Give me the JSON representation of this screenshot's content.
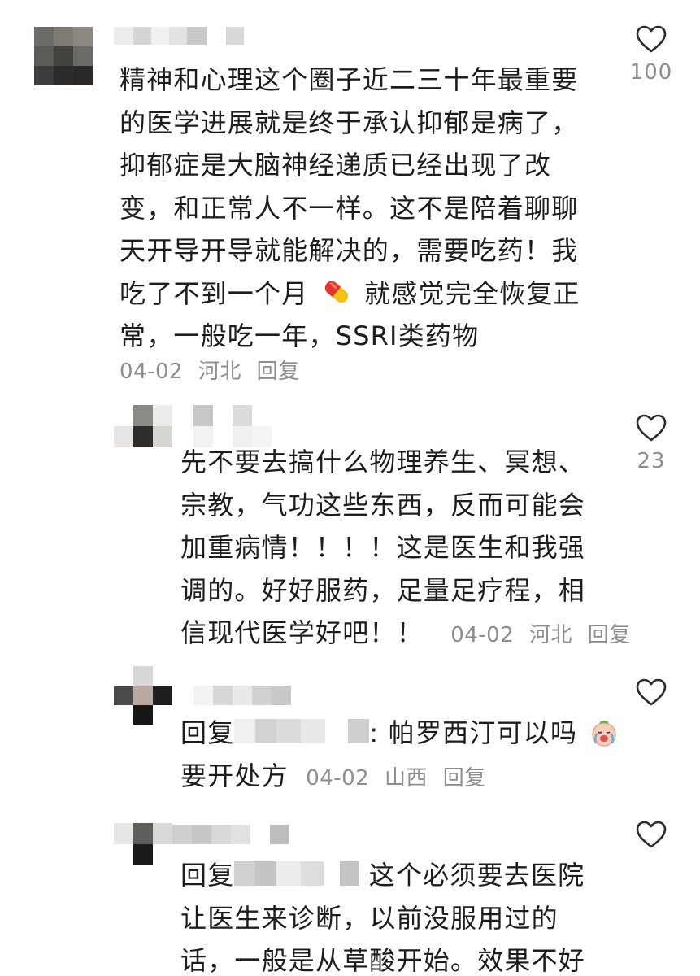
{
  "comments": [
    {
      "id": "c1",
      "text_lines": [
        "精神和心理这个圈子近二三十年最重要",
        "的医学进展就是终于承认抑郁是病了，",
        "抑郁症是大脑神经递质已经出现了改",
        "变，和正常人不一样。这不是陪着聊聊",
        "天开导开导就能解决的，需要吃药！我",
        "吃了不到一个月",
        "就感觉完全恢复正",
        "常，一般吃一年，SSRI类药物"
      ],
      "date": "04-02",
      "location": "河北",
      "reply_label": "回复",
      "likes": "100",
      "emoji": "pill-emoji"
    },
    {
      "id": "c2",
      "text_lines": [
        "先不要去搞什么物理养生、冥想、",
        "宗教，气功这些东西，反而可能会",
        "加重病情！！！！这是医生和我强",
        "调的。好好服药，足量足疗程，相",
        "信现代医学好吧！！"
      ],
      "date": "04-02",
      "location": "河北",
      "reply_label": "回复",
      "likes": "23"
    },
    {
      "id": "c3",
      "reply_prefix": "回复",
      "text_after_name": ": 帕罗西汀可以吗",
      "text_line2": "要开处方",
      "date": "04-02",
      "location": "山西",
      "reply_label": "回复",
      "emoji": "crying-face-emoji"
    },
    {
      "id": "c4",
      "reply_prefix": "回复",
      "text_after_name": " 这个必须要去医院",
      "text_lines": [
        "让医生来诊断，以前没服用过的",
        "话，一般是从草酸开始。效果不好"
      ]
    }
  ],
  "icons": {
    "like": "heart-outline-icon"
  },
  "colors": {
    "text": "#1d1d1d",
    "meta": "#8e8e8e",
    "icon": "#2b2b2b"
  }
}
